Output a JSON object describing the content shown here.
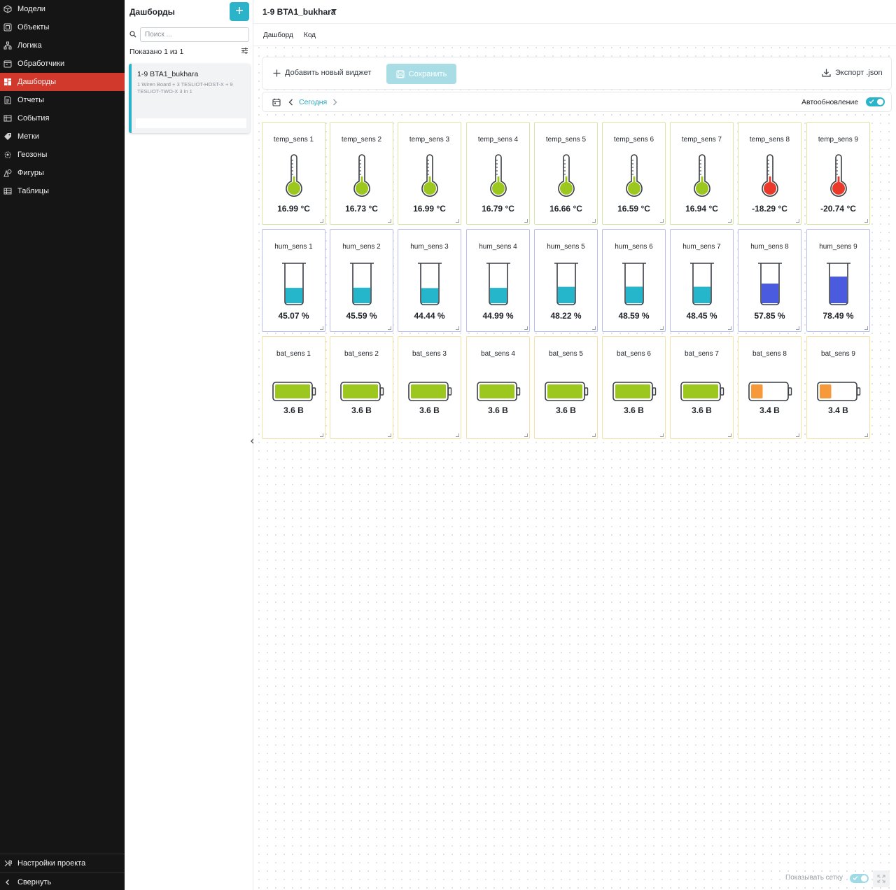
{
  "nav": {
    "items": [
      {
        "label": "Модели",
        "icon": "cube-icon"
      },
      {
        "label": "Объекты",
        "icon": "object-icon"
      },
      {
        "label": "Логика",
        "icon": "logic-tree-icon"
      },
      {
        "label": "Обработчики",
        "icon": "handler-icon"
      },
      {
        "label": "Дашборды",
        "icon": "dashboard-icon",
        "active": true
      },
      {
        "label": "Отчеты",
        "icon": "report-icon"
      },
      {
        "label": "События",
        "icon": "events-icon"
      },
      {
        "label": "Метки",
        "icon": "tag-icon"
      },
      {
        "label": "Геозоны",
        "icon": "geozone-icon"
      },
      {
        "label": "Фигуры",
        "icon": "shapes-icon"
      },
      {
        "label": "Таблицы",
        "icon": "table-icon"
      }
    ],
    "settings_label": "Настройки проекта",
    "collapse_label": "Свернуть",
    "active_color": "#d0392b"
  },
  "dashboards_panel": {
    "title": "Дашборды",
    "add_label": "+",
    "search_placeholder": "Поиск ...",
    "shown_text": "Показано 1 из 1",
    "items": [
      {
        "title": "1-9 BTA1_bukhara",
        "description": "1 Wiren Board + 3 TESLIOT-HOST-X + 9 TESLIOT-TWO-X 3 in 1"
      }
    ]
  },
  "main": {
    "dashboard_title": "1-9 BTA1_bukhara",
    "tabs": [
      "Дашборд",
      "Код"
    ],
    "toolbar": {
      "add_widget": "Добавить новый виджет",
      "save": "Сохранить",
      "export": "Экспорт .json"
    },
    "datebar": {
      "period": "Сегодня",
      "autorefresh_label": "Автообновление",
      "autorefresh_on": true
    },
    "show_grid_label": "Показывать сетку",
    "show_grid_on": true,
    "accent_color": "#2bb3c9"
  },
  "widgets": {
    "temp": [
      {
        "title": "temp_sens 1",
        "value": "16.99 °C",
        "status": "ok"
      },
      {
        "title": "temp_sens 2",
        "value": "16.73 °C",
        "status": "ok"
      },
      {
        "title": "temp_sens 3",
        "value": "16.99 °C",
        "status": "ok"
      },
      {
        "title": "temp_sens 4",
        "value": "16.79 °C",
        "status": "ok"
      },
      {
        "title": "temp_sens 5",
        "value": "16.66 °C",
        "status": "ok"
      },
      {
        "title": "temp_sens 6",
        "value": "16.59 °C",
        "status": "ok"
      },
      {
        "title": "temp_sens 7",
        "value": "16.94 °C",
        "status": "ok"
      },
      {
        "title": "temp_sens 8",
        "value": "-18.29 °C",
        "status": "alert"
      },
      {
        "title": "temp_sens 9",
        "value": "-20.74 °C",
        "status": "alert"
      }
    ],
    "hum": [
      {
        "title": "hum_sens 1",
        "value": "45.07 %",
        "fill": 0.4507,
        "color": "#26b6cc"
      },
      {
        "title": "hum_sens 2",
        "value": "45.59 %",
        "fill": 0.4559,
        "color": "#26b6cc"
      },
      {
        "title": "hum_sens 3",
        "value": "44.44 %",
        "fill": 0.4444,
        "color": "#26b6cc"
      },
      {
        "title": "hum_sens 4",
        "value": "44.99 %",
        "fill": 0.4499,
        "color": "#26b6cc"
      },
      {
        "title": "hum_sens 5",
        "value": "48.22 %",
        "fill": 0.4822,
        "color": "#26b6cc"
      },
      {
        "title": "hum_sens 6",
        "value": "48.59 %",
        "fill": 0.4859,
        "color": "#26b6cc"
      },
      {
        "title": "hum_sens 7",
        "value": "48.45 %",
        "fill": 0.4845,
        "color": "#26b6cc"
      },
      {
        "title": "hum_sens 8",
        "value": "57.85 %",
        "fill": 0.5785,
        "color": "#4a5be0"
      },
      {
        "title": "hum_sens 9",
        "value": "78.49 %",
        "fill": 0.7849,
        "color": "#4a5be0"
      }
    ],
    "bat": [
      {
        "title": "bat_sens 1",
        "value": "3.6 В",
        "level": 1.0,
        "color": "#9bc71e"
      },
      {
        "title": "bat_sens 2",
        "value": "3.6 В",
        "level": 1.0,
        "color": "#9bc71e"
      },
      {
        "title": "bat_sens 3",
        "value": "3.6 В",
        "level": 1.0,
        "color": "#9bc71e"
      },
      {
        "title": "bat_sens 4",
        "value": "3.6 В",
        "level": 1.0,
        "color": "#9bc71e"
      },
      {
        "title": "bat_sens 5",
        "value": "3.6 В",
        "level": 1.0,
        "color": "#9bc71e"
      },
      {
        "title": "bat_sens 6",
        "value": "3.6 В",
        "level": 1.0,
        "color": "#9bc71e"
      },
      {
        "title": "bat_sens 7",
        "value": "3.6 В",
        "level": 1.0,
        "color": "#9bc71e"
      },
      {
        "title": "bat_sens 8",
        "value": "3.4 В",
        "level": 0.33,
        "color": "#f5993a"
      },
      {
        "title": "bat_sens 9",
        "value": "3.4 В",
        "level": 0.33,
        "color": "#f5993a"
      }
    ],
    "colors": {
      "temp_ok": "#9bc71e",
      "temp_alert": "#e8392b"
    }
  }
}
